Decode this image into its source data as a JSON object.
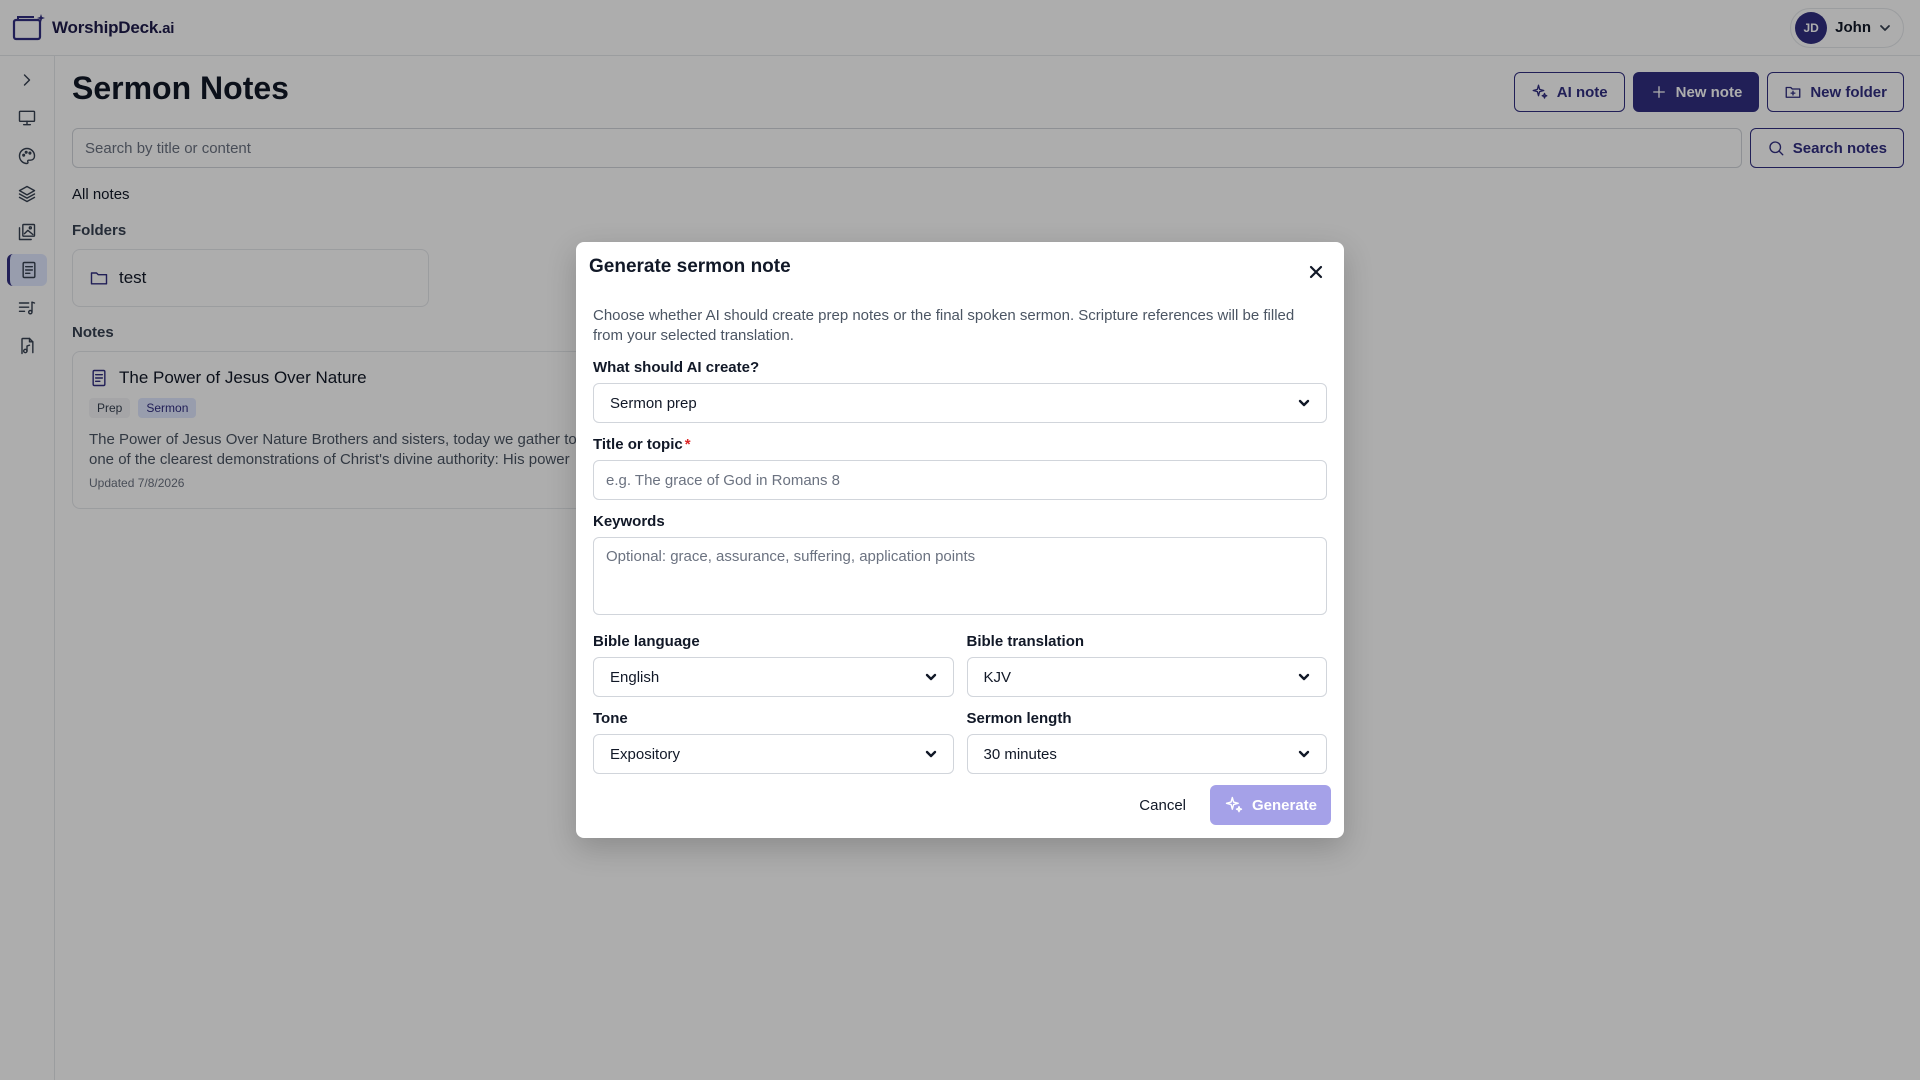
{
  "app": {
    "logo_text": "WorshipDeck",
    "logo_suffix": ".ai"
  },
  "user": {
    "initials": "JD",
    "name": "John"
  },
  "page": {
    "title": "Sermon Notes",
    "actions": {
      "ai_note": "AI note",
      "new_note": "New note",
      "new_folder": "New folder"
    },
    "search": {
      "placeholder": "Search by title or content",
      "button": "Search notes"
    },
    "all_notes": "All notes",
    "folders_label": "Folders",
    "folders": [
      {
        "name": "test"
      }
    ],
    "notes_label": "Notes",
    "notes": [
      {
        "title": "The Power of Jesus Over Nature",
        "tags": [
          "Prep",
          "Sermon"
        ],
        "excerpt": "The Power of Jesus Over Nature Brothers and sisters, today we gather to one of the clearest demonstrations of Christ's divine authority: His power",
        "updated": "Updated 7/8/2026"
      }
    ]
  },
  "modal": {
    "title": "Generate sermon note",
    "description": "Choose whether AI should create prep notes or the final spoken sermon. Scripture references will be filled from your selected translation.",
    "create_label": "What should AI create?",
    "create_value": "Sermon prep",
    "title_label": "Title or topic",
    "title_required": "*",
    "title_placeholder": "e.g. The grace of God in Romans 8",
    "keywords_label": "Keywords",
    "keywords_placeholder": "Optional: grace, assurance, suffering, application points",
    "language_label": "Bible language",
    "language_value": "English",
    "translation_label": "Bible translation",
    "translation_value": "KJV",
    "tone_label": "Tone",
    "tone_value": "Expository",
    "length_label": "Sermon length",
    "length_value": "30 minutes",
    "cancel": "Cancel",
    "generate": "Generate"
  },
  "colors": {
    "brand": "#312e81",
    "brand_light": "#e0e7ff",
    "generate_disabled": "#a5a1e8",
    "required": "#dc2626",
    "overlay": "rgba(0,0,0,0.32)"
  },
  "icons": {
    "sidebar": [
      "chevron-right-icon",
      "presentation-icon",
      "palette-icon",
      "layers-icon",
      "images-icon",
      "notes-icon",
      "music-list-icon",
      "file-music-icon"
    ]
  }
}
